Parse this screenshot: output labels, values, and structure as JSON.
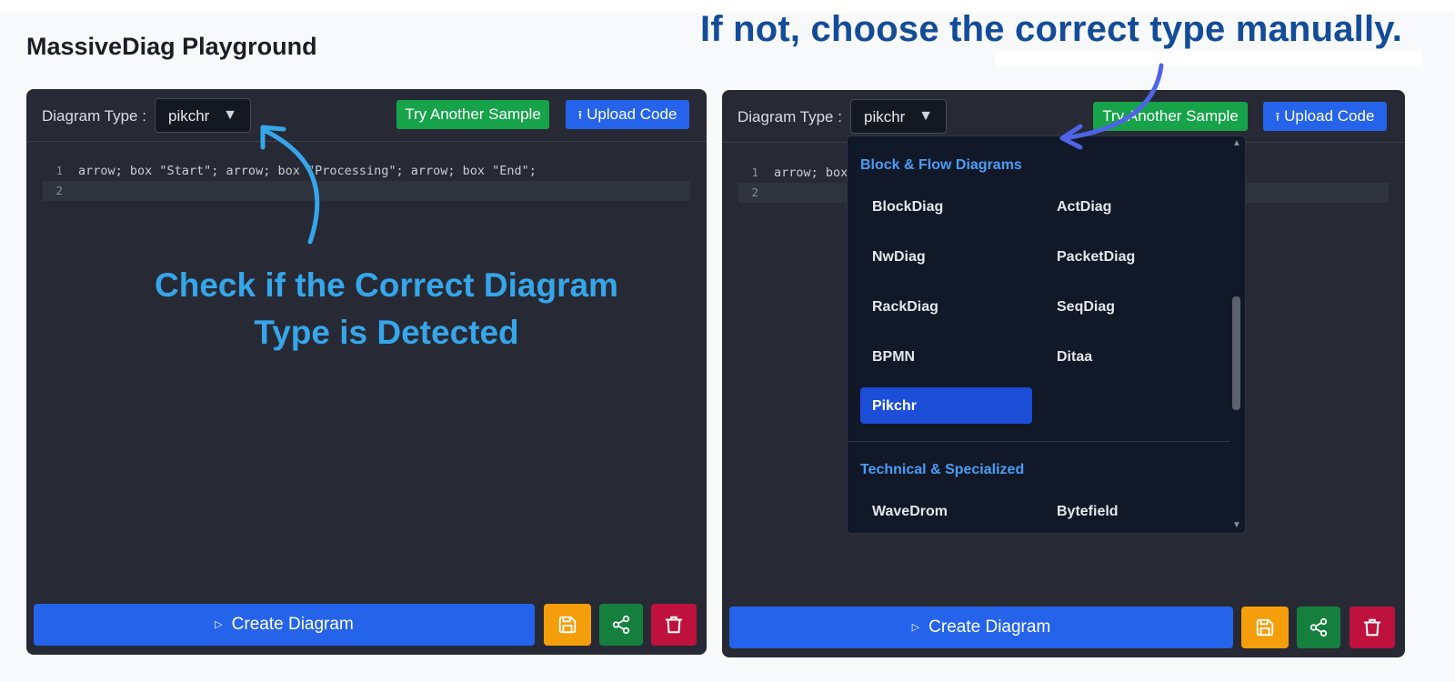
{
  "page": {
    "title": "MassiveDiag Playground"
  },
  "annotations": {
    "top": "If not, choose the correct type manually.",
    "left": "Check if the Correct Diagram Type is Detected"
  },
  "colors": {
    "panel_bg": "#272a34",
    "primary_blue": "#2563eb",
    "green": "#16a34a",
    "save_yellow": "#f59e0b",
    "share_green": "#15803d",
    "delete_red": "#be123c",
    "annotation_dark_blue": "#134c98",
    "annotation_light_blue": "#36a6ea"
  },
  "left_panel": {
    "type_label": "Diagram Type :",
    "selected_type": "pikchr",
    "sample_button": "Try Another Sample",
    "upload_button": "Upload Code",
    "editor": {
      "lines": [
        {
          "num": "1",
          "code": "arrow; box \"Start\"; arrow; box \"Processing\"; arrow; box \"End\";"
        },
        {
          "num": "2",
          "code": ""
        }
      ]
    },
    "create_button": "Create Diagram"
  },
  "right_panel": {
    "type_label": "Diagram Type :",
    "selected_type": "pikchr",
    "sample_button": "Try Another Sample",
    "upload_button": "Upload Code",
    "editor": {
      "lines": [
        {
          "num": "1",
          "code": "arrow; box"
        },
        {
          "num": "2",
          "code": ""
        }
      ]
    },
    "create_button": "Create Diagram"
  },
  "dropdown": {
    "groups": [
      {
        "label": "Block & Flow Diagrams",
        "items": [
          "BlockDiag",
          "ActDiag",
          "NwDiag",
          "PacketDiag",
          "RackDiag",
          "SeqDiag",
          "BPMN",
          "Ditaa",
          "Pikchr"
        ]
      },
      {
        "label": "Technical & Specialized",
        "items": [
          "WaveDrom",
          "Bytefield"
        ]
      }
    ],
    "selected": "Pikchr"
  },
  "icons": {
    "caret": "▼",
    "upload": "upload-icon",
    "play": "play-icon",
    "save": "floppy-disk-icon",
    "share": "share-icon",
    "delete": "trash-icon"
  }
}
